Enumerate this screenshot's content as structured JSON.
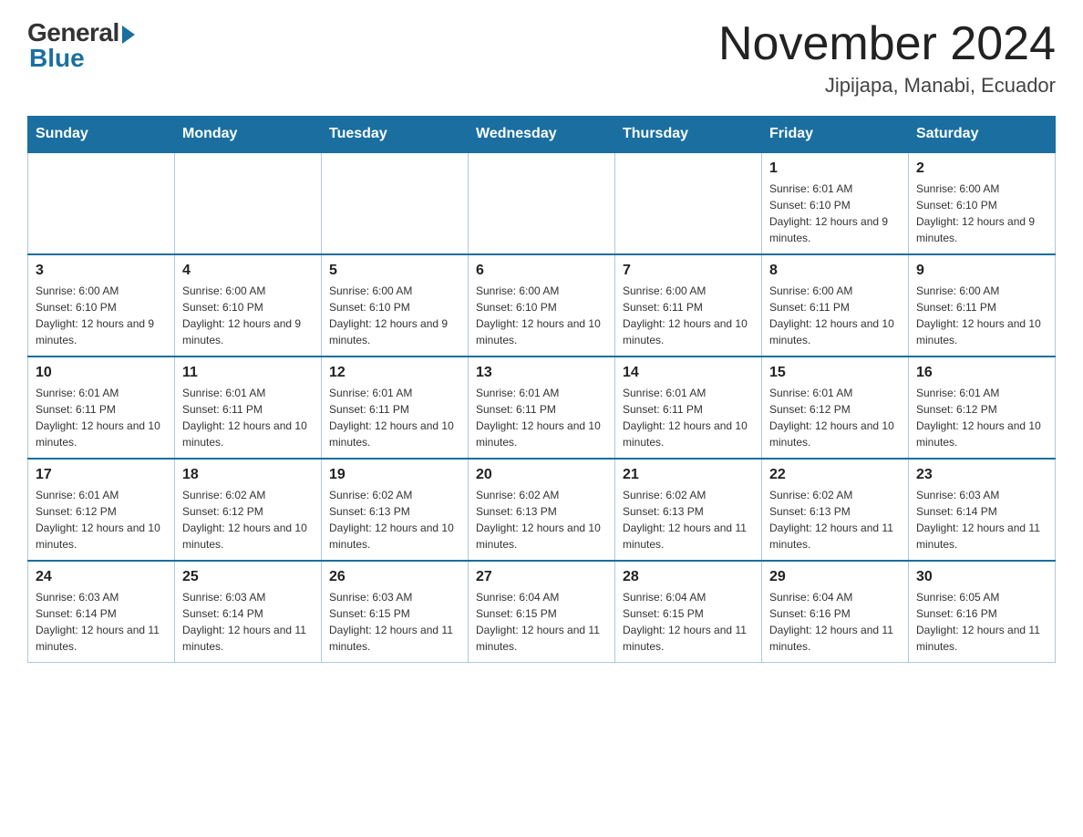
{
  "logo": {
    "general": "General",
    "blue": "Blue"
  },
  "title": "November 2024",
  "subtitle": "Jipijapa, Manabi, Ecuador",
  "days_of_week": [
    "Sunday",
    "Monday",
    "Tuesday",
    "Wednesday",
    "Thursday",
    "Friday",
    "Saturday"
  ],
  "weeks": [
    [
      {
        "day": "",
        "info": ""
      },
      {
        "day": "",
        "info": ""
      },
      {
        "day": "",
        "info": ""
      },
      {
        "day": "",
        "info": ""
      },
      {
        "day": "",
        "info": ""
      },
      {
        "day": "1",
        "info": "Sunrise: 6:01 AM\nSunset: 6:10 PM\nDaylight: 12 hours and 9 minutes."
      },
      {
        "day": "2",
        "info": "Sunrise: 6:00 AM\nSunset: 6:10 PM\nDaylight: 12 hours and 9 minutes."
      }
    ],
    [
      {
        "day": "3",
        "info": "Sunrise: 6:00 AM\nSunset: 6:10 PM\nDaylight: 12 hours and 9 minutes."
      },
      {
        "day": "4",
        "info": "Sunrise: 6:00 AM\nSunset: 6:10 PM\nDaylight: 12 hours and 9 minutes."
      },
      {
        "day": "5",
        "info": "Sunrise: 6:00 AM\nSunset: 6:10 PM\nDaylight: 12 hours and 9 minutes."
      },
      {
        "day": "6",
        "info": "Sunrise: 6:00 AM\nSunset: 6:10 PM\nDaylight: 12 hours and 10 minutes."
      },
      {
        "day": "7",
        "info": "Sunrise: 6:00 AM\nSunset: 6:11 PM\nDaylight: 12 hours and 10 minutes."
      },
      {
        "day": "8",
        "info": "Sunrise: 6:00 AM\nSunset: 6:11 PM\nDaylight: 12 hours and 10 minutes."
      },
      {
        "day": "9",
        "info": "Sunrise: 6:00 AM\nSunset: 6:11 PM\nDaylight: 12 hours and 10 minutes."
      }
    ],
    [
      {
        "day": "10",
        "info": "Sunrise: 6:01 AM\nSunset: 6:11 PM\nDaylight: 12 hours and 10 minutes."
      },
      {
        "day": "11",
        "info": "Sunrise: 6:01 AM\nSunset: 6:11 PM\nDaylight: 12 hours and 10 minutes."
      },
      {
        "day": "12",
        "info": "Sunrise: 6:01 AM\nSunset: 6:11 PM\nDaylight: 12 hours and 10 minutes."
      },
      {
        "day": "13",
        "info": "Sunrise: 6:01 AM\nSunset: 6:11 PM\nDaylight: 12 hours and 10 minutes."
      },
      {
        "day": "14",
        "info": "Sunrise: 6:01 AM\nSunset: 6:11 PM\nDaylight: 12 hours and 10 minutes."
      },
      {
        "day": "15",
        "info": "Sunrise: 6:01 AM\nSunset: 6:12 PM\nDaylight: 12 hours and 10 minutes."
      },
      {
        "day": "16",
        "info": "Sunrise: 6:01 AM\nSunset: 6:12 PM\nDaylight: 12 hours and 10 minutes."
      }
    ],
    [
      {
        "day": "17",
        "info": "Sunrise: 6:01 AM\nSunset: 6:12 PM\nDaylight: 12 hours and 10 minutes."
      },
      {
        "day": "18",
        "info": "Sunrise: 6:02 AM\nSunset: 6:12 PM\nDaylight: 12 hours and 10 minutes."
      },
      {
        "day": "19",
        "info": "Sunrise: 6:02 AM\nSunset: 6:13 PM\nDaylight: 12 hours and 10 minutes."
      },
      {
        "day": "20",
        "info": "Sunrise: 6:02 AM\nSunset: 6:13 PM\nDaylight: 12 hours and 10 minutes."
      },
      {
        "day": "21",
        "info": "Sunrise: 6:02 AM\nSunset: 6:13 PM\nDaylight: 12 hours and 11 minutes."
      },
      {
        "day": "22",
        "info": "Sunrise: 6:02 AM\nSunset: 6:13 PM\nDaylight: 12 hours and 11 minutes."
      },
      {
        "day": "23",
        "info": "Sunrise: 6:03 AM\nSunset: 6:14 PM\nDaylight: 12 hours and 11 minutes."
      }
    ],
    [
      {
        "day": "24",
        "info": "Sunrise: 6:03 AM\nSunset: 6:14 PM\nDaylight: 12 hours and 11 minutes."
      },
      {
        "day": "25",
        "info": "Sunrise: 6:03 AM\nSunset: 6:14 PM\nDaylight: 12 hours and 11 minutes."
      },
      {
        "day": "26",
        "info": "Sunrise: 6:03 AM\nSunset: 6:15 PM\nDaylight: 12 hours and 11 minutes."
      },
      {
        "day": "27",
        "info": "Sunrise: 6:04 AM\nSunset: 6:15 PM\nDaylight: 12 hours and 11 minutes."
      },
      {
        "day": "28",
        "info": "Sunrise: 6:04 AM\nSunset: 6:15 PM\nDaylight: 12 hours and 11 minutes."
      },
      {
        "day": "29",
        "info": "Sunrise: 6:04 AM\nSunset: 6:16 PM\nDaylight: 12 hours and 11 minutes."
      },
      {
        "day": "30",
        "info": "Sunrise: 6:05 AM\nSunset: 6:16 PM\nDaylight: 12 hours and 11 minutes."
      }
    ]
  ]
}
